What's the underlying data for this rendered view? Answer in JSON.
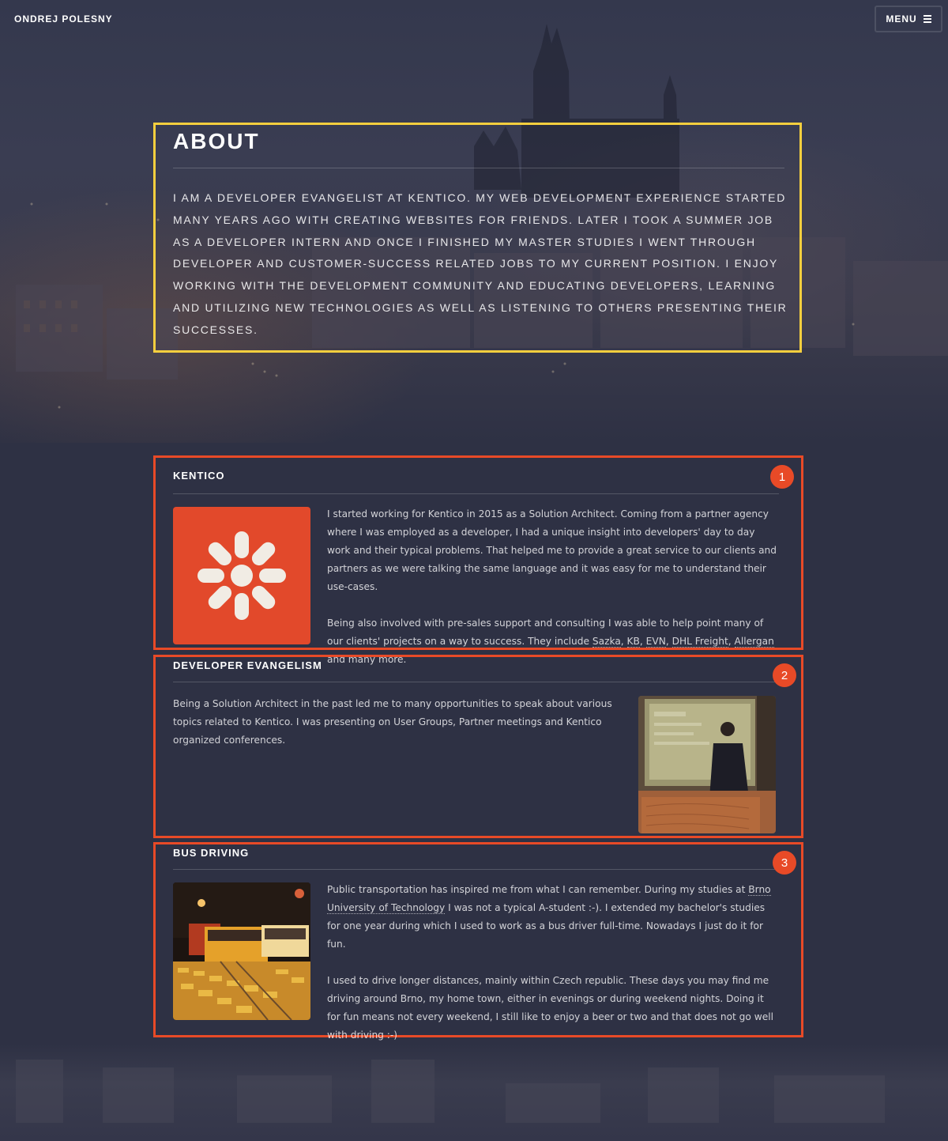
{
  "header": {
    "site_name": "ONDREJ POLESNY",
    "menu_label": "MENU"
  },
  "about": {
    "title": "ABOUT",
    "text": "I am a developer evangelist at Kentico. My web development experience started many years ago with creating websites for friends. Later I took a summer job as a developer intern and once I finished my master studies I went through developer and customer-success related jobs to my current position. I enjoy working with the development community and educating developers, learning and utilizing new technologies as well as listening to others presenting their successes."
  },
  "sections": [
    {
      "badge": "1",
      "title": "KENTICO",
      "image": "kentico-logo",
      "p1": "I started working for Kentico in 2015 as a Solution Architect. Coming from a partner agency where I was employed as a developer, I had a unique insight into developers' day to day work and their typical problems. That helped me to provide a great service to our clients and partners as we were talking the same language and it was easy for me to understand their use-cases.",
      "p2_before": "Being also involved with pre-sales support and consulting I was able to help point many of our clients' projects on a way to success. They include ",
      "links": [
        "Sazka",
        "KB",
        "EVN",
        "DHL Freight",
        "Allergan"
      ],
      "p2_after": " and many more."
    },
    {
      "badge": "2",
      "title": "DEVELOPER EVANGELISM",
      "image": "speaker-photo",
      "p1": "Being a Solution Architect in the past led me to many opportunities to speak about various topics related to Kentico. I was presenting on User Groups, Partner meetings and Kentico organized conferences."
    },
    {
      "badge": "3",
      "title": "BUS DRIVING",
      "image": "bus-photo",
      "p1_before": "Public transportation has inspired me from what I can remember. During my studies at ",
      "link": "Brno University of Technology",
      "p1_after": " I was not a typical A-student :-). I extended my bachelor's studies for one year during which I used to work as a bus driver full-time. Nowadays I just do it for fun.",
      "p2": "I used to drive longer distances, mainly within Czech republic. These days you may find me driving around Brno, my home town, either in evenings or during weekend nights. Doing it for fun means not every weekend, I still like to enjoy a beer or two and that does not go well with driving :-)"
    }
  ],
  "colors": {
    "background": "#2e3144",
    "about_border": "#f6cf3e",
    "card_border": "#e84a27",
    "kentico_orange": "#e2492b"
  }
}
